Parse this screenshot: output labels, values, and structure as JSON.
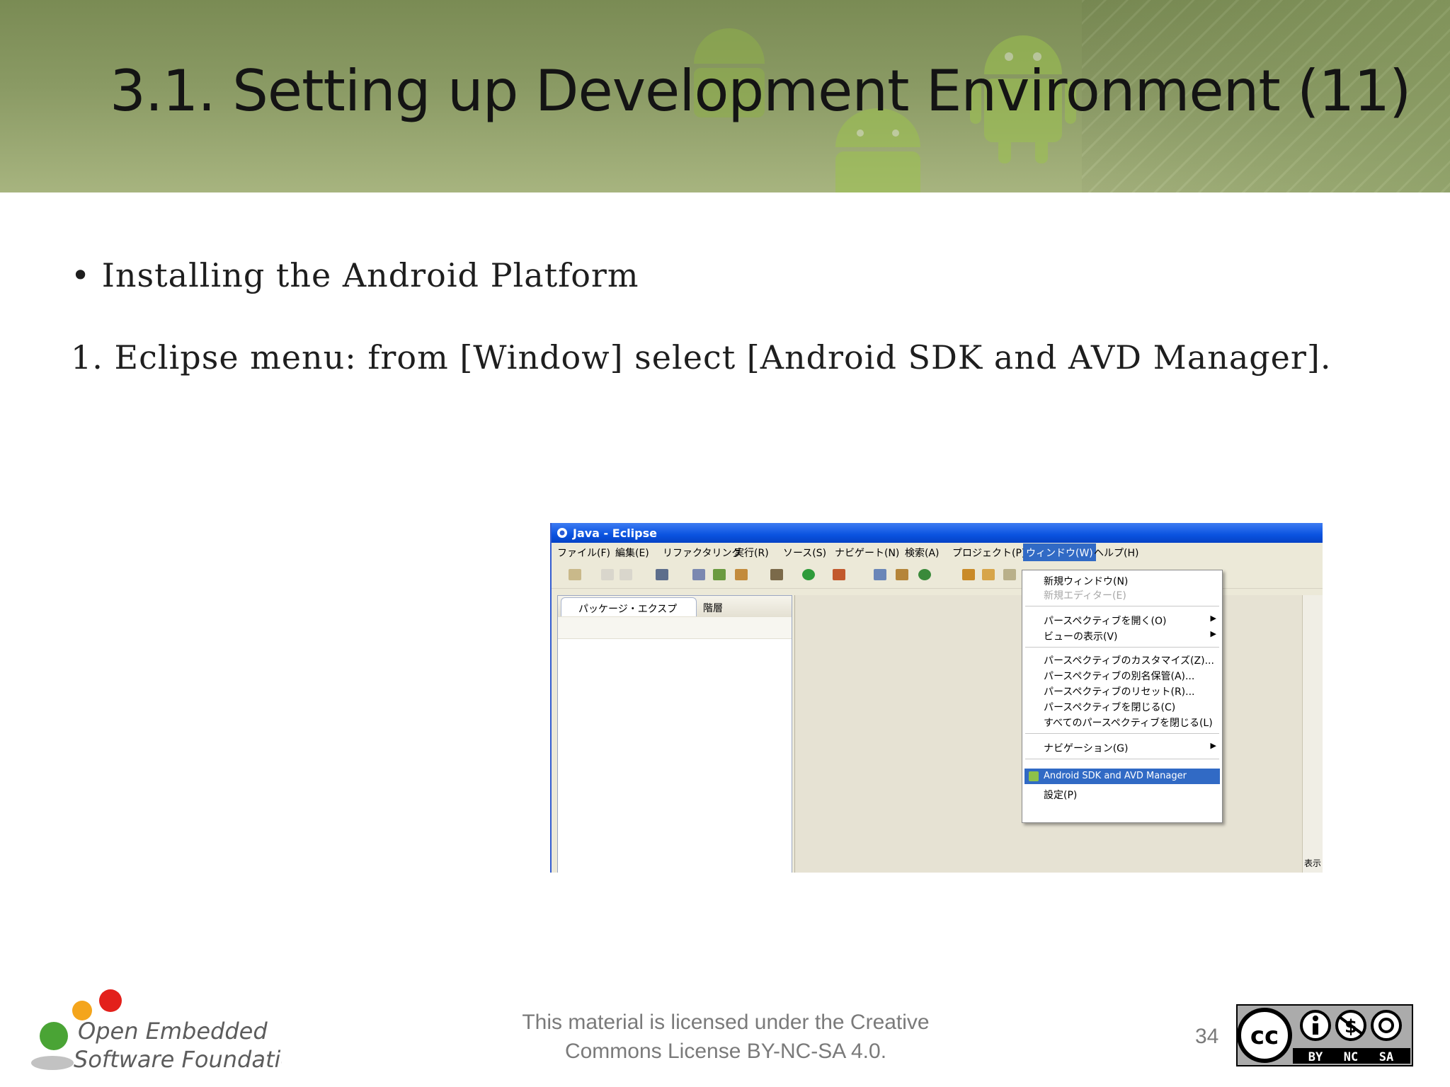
{
  "slide": {
    "title": "3.1. Setting up Development Environment (11)",
    "bullet": "• Installing the Android Platform",
    "step": "1.  Eclipse menu: from [Window] select [Android SDK and AVD Manager].",
    "page_number": "34"
  },
  "footer": {
    "license_line1": "This material is licensed under the Creative",
    "license_line2": "Commons License BY-NC-SA 4.0.",
    "logo_line1": "Open Embedded",
    "logo_line2": "Software Foundation",
    "cc_labels": [
      "cc",
      "BY",
      "NC",
      "SA"
    ]
  },
  "eclipse": {
    "window_title": "Java - Eclipse",
    "menus": [
      "ファイル(F)",
      "編集(E)",
      "リファクタリング",
      "実行(R)",
      "ソース(S)",
      "ナビゲート(N)",
      "検索(A)",
      "プロジェクト(P)",
      "ウィンドウ(W)",
      "ヘルプ(H)"
    ],
    "active_menu": "ウィンドウ(W)",
    "panel_tab": "パッケージ・エクスプ",
    "panel_tab2": "階層",
    "window_menu_items": [
      {
        "label": "新規ウィンドウ(N)"
      },
      {
        "label": "新規エディター(E)",
        "disabled": true
      },
      {
        "label": "パースペクティブを開く(O)",
        "submenu": true
      },
      {
        "label": "ビューの表示(V)",
        "submenu": true
      },
      {
        "label": "パースペクティブのカスタマイズ(Z)..."
      },
      {
        "label": "パースペクティブの別名保管(A)..."
      },
      {
        "label": "パースペクティブのリセット(R)..."
      },
      {
        "label": "パースペクティブを閉じる(C)"
      },
      {
        "label": "すべてのパースペクティブを閉じる(L)"
      },
      {
        "label": "ナビゲーション(G)",
        "submenu": true
      },
      {
        "label": "Android SDK and AVD Manager",
        "selected": true
      },
      {
        "label": "設定(P)"
      }
    ],
    "right_rail_label": "表示"
  },
  "colors": {
    "banner": "#8a9a64",
    "title_text": "#141414",
    "selection_blue": "#316ac5",
    "titlebar_blue": "#0a53e0",
    "footer_text": "#7a7a7a"
  }
}
